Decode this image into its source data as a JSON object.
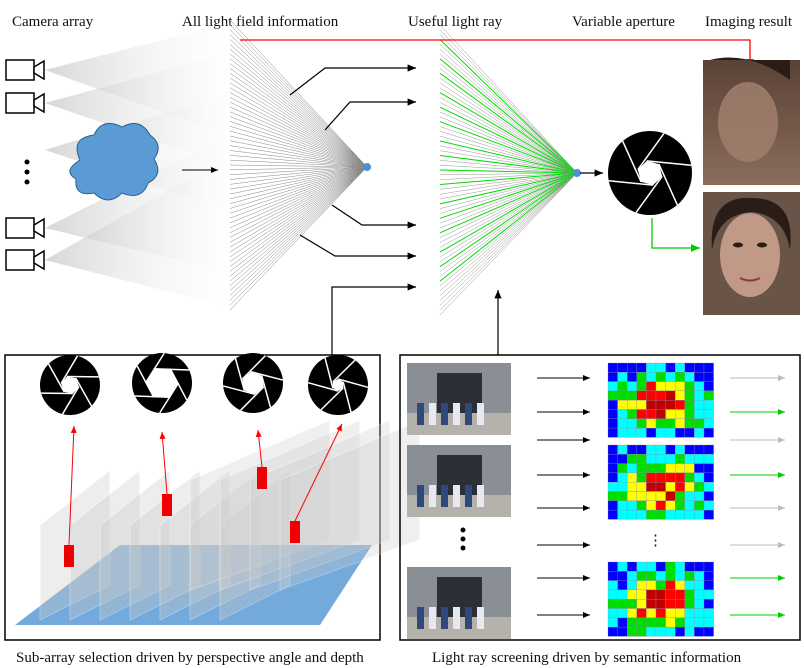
{
  "labels": {
    "camera_array": "Camera array",
    "all_light_field": "All light field information",
    "useful_light_ray": "Useful light ray",
    "variable_aperture": "Variable aperture",
    "imaging_result": "Imaging result",
    "subarray_caption": "Sub-array selection driven by perspective angle and depth",
    "screening_caption": "Light ray screening driven by semantic information"
  },
  "colors": {
    "highlight_arrow": "#ff0000",
    "useful_ray": "#00dd00",
    "cloud": "#5b9bd5",
    "focal_point": "#4a90d9",
    "depth_plane": "#5b9bd5"
  },
  "icons": [
    "camera-icon",
    "cloud-icon",
    "aperture-icon",
    "ellipsis-icon"
  ],
  "heatmap_palette": [
    "#0000ff",
    "#00ffff",
    "#00dd00",
    "#ffff00",
    "#ff0000",
    "#c00000"
  ]
}
